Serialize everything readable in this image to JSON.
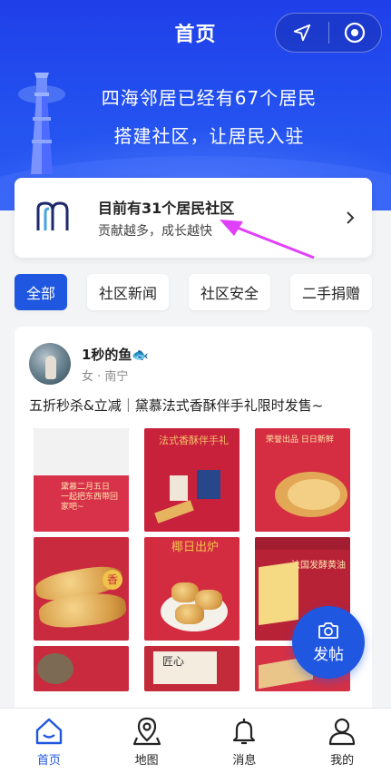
{
  "header": {
    "title": "首页",
    "hero_line1": "四海邻居已经有67个居民",
    "hero_line2": "搭建社区，让居民入驻",
    "capsule_icons": [
      "location-arrow-icon",
      "target-circle-icon"
    ]
  },
  "community_card": {
    "title": "目前有31个居民社区",
    "subtitle": "贡献越多，成长越快"
  },
  "tabs": [
    {
      "label": "全部",
      "active": true
    },
    {
      "label": "社区新闻",
      "active": false
    },
    {
      "label": "社区安全",
      "active": false
    },
    {
      "label": "二手捐赠",
      "active": false
    }
  ],
  "post": {
    "username": "1秒的鱼🐟",
    "meta": "女 · 南宁",
    "title": "五折秒杀&立减｜黛慕法式香酥伴手礼限时发售~",
    "image_texts": {
      "img2": "法式香酥伴手礼",
      "img3": "荣誉出品 日日新鲜",
      "img4": "香",
      "img5": "椰日出炉",
      "img6": "法国发酵黄油",
      "img8": "匠心"
    }
  },
  "fab": {
    "label": "发帖",
    "icon": "camera-icon"
  },
  "bottom_nav": [
    {
      "label": "首页",
      "icon": "home-icon",
      "active": true
    },
    {
      "label": "地图",
      "icon": "map-pin-icon",
      "active": false
    },
    {
      "label": "消息",
      "icon": "bell-icon",
      "active": false
    },
    {
      "label": "我的",
      "icon": "user-icon",
      "active": false
    }
  ],
  "colors": {
    "primary": "#1f57e0",
    "hero": "#2453f0",
    "accent_arrow": "#e040fb"
  }
}
